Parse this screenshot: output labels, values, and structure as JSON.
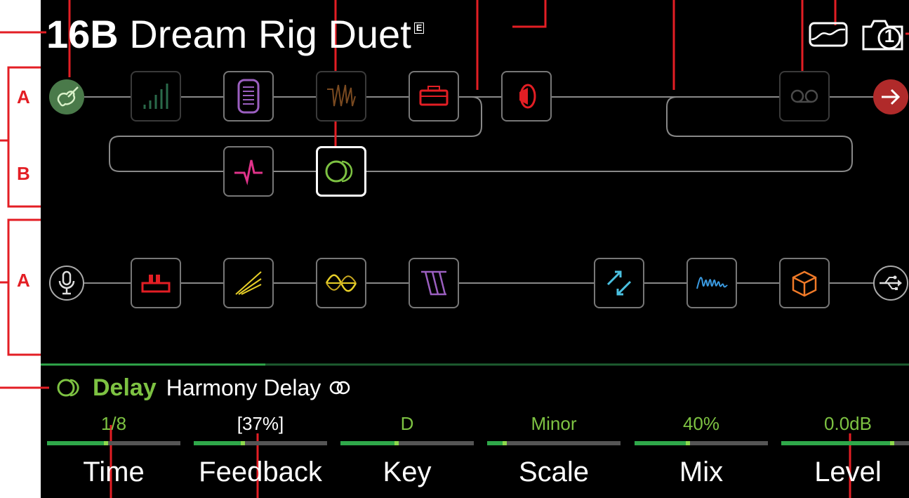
{
  "preset": {
    "number": "16B",
    "name": "Dream Rig Duet",
    "edited_mark": "E"
  },
  "snapshot": {
    "number": "1"
  },
  "path_labels": {
    "path1_a": "A",
    "path1_b": "B",
    "path2_a": "A"
  },
  "signal_flow": {
    "path1a_input": "guitar-input-icon",
    "path1a_blocks": [
      "eq-icon",
      "wah-icon",
      "filter-icon",
      "amp-icon",
      "cab-icon",
      "looper-icon"
    ],
    "path1a_output": "output-arrow-icon",
    "path1b_blocks": [
      "compressor-icon",
      "delay-icon"
    ],
    "path2a_input": "mic-input-icon",
    "path2a_blocks": [
      "preamp-icon",
      "distortion-icon",
      "modulation-icon",
      "filter-icon",
      "send-return-icon",
      "reverb-icon",
      "volume-icon"
    ],
    "path2a_output": "usb-output-icon"
  },
  "selected_block": {
    "category": "Delay",
    "model": "Harmony Delay",
    "stereo_icon": "stereo-icon"
  },
  "params": [
    {
      "value": "1/8",
      "name": "Time",
      "level": 0.44
    },
    {
      "value": "[37%]",
      "name": "Feedback",
      "level": 0.37
    },
    {
      "value": "D",
      "name": "Key",
      "level": 0.42
    },
    {
      "value": "Minor",
      "name": "Scale",
      "level": 0.13
    },
    {
      "value": "40%",
      "name": "Mix",
      "level": 0.4
    },
    {
      "value": "0.0dB",
      "name": "Level",
      "level": 0.83
    }
  ],
  "colors": {
    "accent_green": "#7dc242",
    "annotation_red": "#e31e24",
    "wire_grey": "#888888"
  }
}
